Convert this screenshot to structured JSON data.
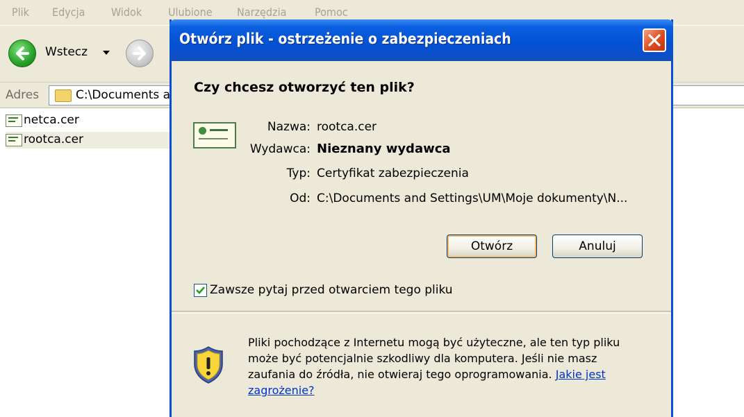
{
  "explorer": {
    "menu": [
      "Plik",
      "Edycja",
      "Widok",
      "Ulubione",
      "Narzędzia",
      "Pomoc"
    ],
    "toolbar": {
      "back_label": "Wstecz"
    },
    "address": {
      "label": "Adres",
      "path": "C:\\Documents a"
    },
    "files": [
      {
        "name": "netca.cer"
      },
      {
        "name": "rootca.cer"
      }
    ]
  },
  "dialog": {
    "title": "Otwórz plik - ostrzeżenie o zabezpieczeniach",
    "question": "Czy chcesz otworzyć ten plik?",
    "fields": [
      {
        "label": "Nazwa:",
        "value": "rootca.cer"
      },
      {
        "label": "Wydawca:",
        "value": "Nieznany wydawca"
      },
      {
        "label": "Typ:",
        "value": "Certyfikat zabezpieczenia"
      },
      {
        "label": "Od:",
        "value": "C:\\Documents and Settings\\UM\\Moje dokumenty\\N..."
      }
    ],
    "buttons": {
      "open": "Otwórz",
      "cancel": "Anuluj"
    },
    "checkbox": {
      "label": "Zawsze pytaj przed otwarciem tego pliku",
      "checked": true
    },
    "warning": {
      "line1": "Pliki pochodzące z Internetu mogą być użyteczne, ale ten typ pliku",
      "line2": "może być potencjalnie szkodliwy dla komputera. Jeśli nie masz",
      "line3": "zaufania do źródła, nie otwieraj tego oprogramowania.",
      "link_part1": "Jakie jest",
      "link_part2": "zagrożenie?"
    }
  },
  "colors": {
    "titlebar": "#0352d4",
    "window_bg": "#ece9d8",
    "close": "#e04a1f",
    "link": "#0033cc"
  }
}
